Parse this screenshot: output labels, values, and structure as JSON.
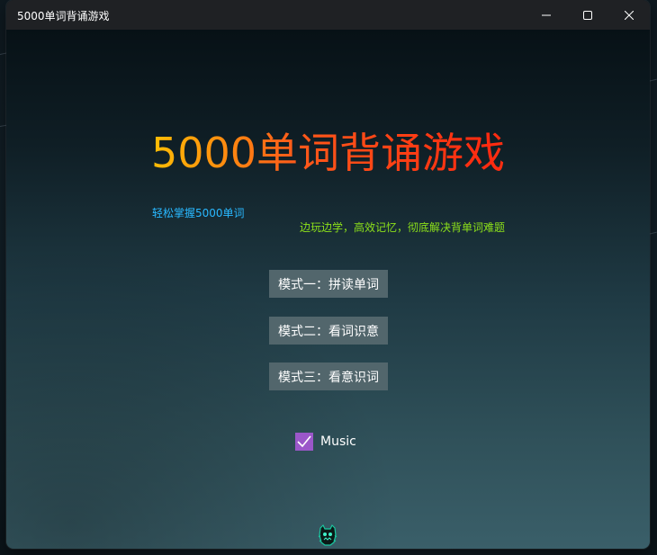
{
  "window": {
    "title": "5000单词背诵游戏",
    "controls": {
      "minimize_icon": "minimize-icon",
      "maximize_icon": "maximize-icon",
      "close_icon": "close-icon"
    }
  },
  "main": {
    "title": "5000单词背诵游戏",
    "tagline_left": "轻松掌握5000单词",
    "tagline_right": "边玩边学，高效记忆，彻底解决背单词难题",
    "modes": [
      {
        "label": "模式一：拼读单词"
      },
      {
        "label": "模式二：看词识意"
      },
      {
        "label": "模式三：看意识词"
      }
    ],
    "music": {
      "label": "Music",
      "checked": true
    },
    "footer_icon": "monster-icon"
  },
  "colors": {
    "title_gradient": [
      "#ff8a00",
      "#ffd200",
      "#ff5a1a",
      "#ff2a10"
    ],
    "tagline_left": "#29b8ff",
    "tagline_right": "#8ce01a",
    "button_bg": "#52666c",
    "checkbox": "#9b57c9",
    "titlebar": "#1f2124"
  }
}
